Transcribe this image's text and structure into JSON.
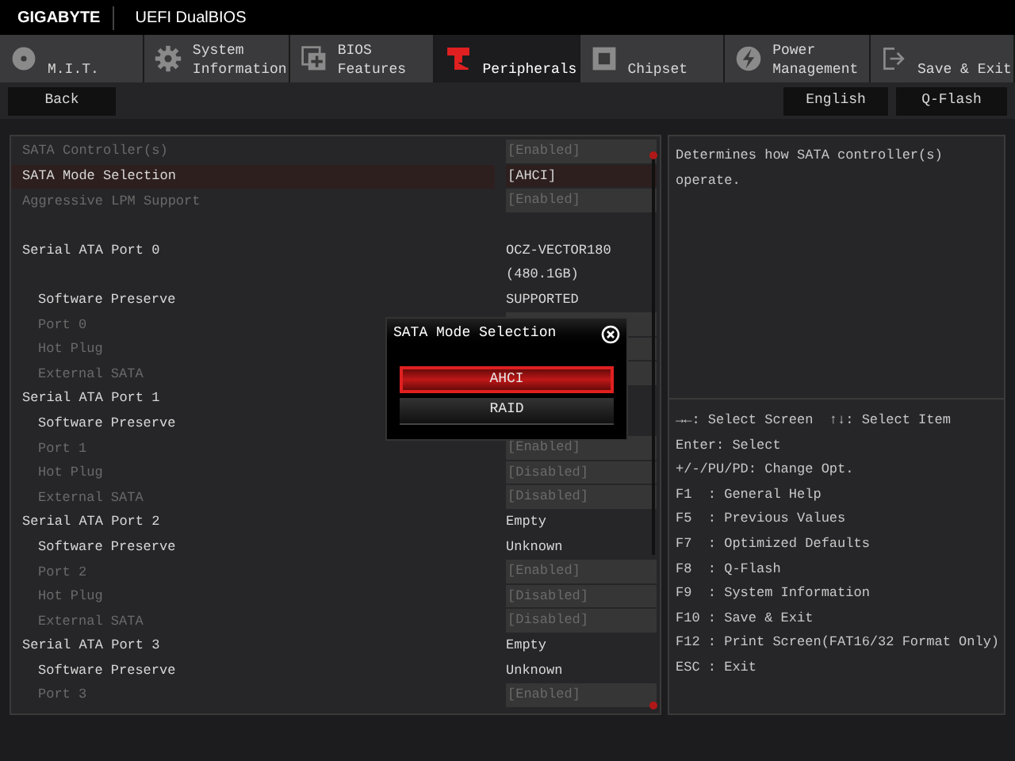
{
  "header": {
    "brand": "GIGABYTE",
    "title": "UEFI DualBIOS"
  },
  "tabs": [
    {
      "label": "M.I.T.",
      "selected": false
    },
    {
      "label": "System Information",
      "selected": false
    },
    {
      "label": "BIOS Features",
      "selected": false
    },
    {
      "label": "Peripherals",
      "selected": true
    },
    {
      "label": "Chipset",
      "selected": false
    },
    {
      "label": "Power Management",
      "selected": false
    },
    {
      "label": "Save & Exit",
      "selected": false
    }
  ],
  "toolbar": {
    "back": "Back",
    "language": "English",
    "qflash": "Q-Flash"
  },
  "settings": [
    {
      "items": [
        {
          "label": "SATA Controller(s)",
          "kind": "option",
          "value": "[Enabled]",
          "disabled": true,
          "selected": false
        },
        {
          "label": "SATA Mode Selection",
          "kind": "option",
          "value": "[AHCI]",
          "disabled": false,
          "selected": true
        },
        {
          "label": "Aggressive LPM Support",
          "kind": "option",
          "value": "[Enabled]",
          "disabled": true,
          "selected": false
        }
      ]
    },
    {
      "items": [
        {
          "label": "Serial ATA Port 0",
          "kind": "info",
          "value_lines": [
            "OCZ-VECTOR180",
            "(480.1GB)"
          ],
          "children": [
            {
              "label": "Software Preserve",
              "kind": "info",
              "value_lines": [
                "SUPPORTED"
              ]
            },
            {
              "label": "Port 0",
              "kind": "option",
              "disabled": true,
              "selected": false
            },
            {
              "label": "Hot Plug",
              "kind": "option",
              "disabled": true,
              "selected": false
            },
            {
              "label": "External SATA",
              "kind": "option",
              "disabled": true,
              "selected": false
            }
          ]
        },
        {
          "label": "Serial ATA Port 1",
          "kind": "info",
          "children": [
            {
              "label": "Software Preserve",
              "kind": "info"
            },
            {
              "label": "Port 1",
              "kind": "option",
              "value": "[Enabled]",
              "disabled": true,
              "selected": false
            },
            {
              "label": "Hot Plug",
              "kind": "option",
              "value": "[Disabled]",
              "disabled": true,
              "selected": false
            },
            {
              "label": "External SATA",
              "kind": "option",
              "value": "[Disabled]",
              "disabled": true,
              "selected": false
            }
          ]
        },
        {
          "label": "Serial ATA Port 2",
          "kind": "info",
          "value_lines": [
            "Empty"
          ],
          "children": [
            {
              "label": "Software Preserve",
              "kind": "info",
              "value_lines": [
                "Unknown"
              ]
            },
            {
              "label": "Port 2",
              "kind": "option",
              "value": "[Enabled]",
              "disabled": true,
              "selected": false
            },
            {
              "label": "Hot Plug",
              "kind": "option",
              "value": "[Disabled]",
              "disabled": true,
              "selected": false
            },
            {
              "label": "External SATA",
              "kind": "option",
              "value": "[Disabled]",
              "disabled": true,
              "selected": false
            }
          ]
        },
        {
          "label": "Serial ATA Port 3",
          "kind": "info",
          "value_lines": [
            "Empty"
          ],
          "children": [
            {
              "label": "Software Preserve",
              "kind": "info",
              "value_lines": [
                "Unknown"
              ]
            },
            {
              "label": "Port 3",
              "kind": "option",
              "value": "[Enabled]",
              "disabled": true,
              "selected": false
            }
          ]
        }
      ]
    }
  ],
  "popup": {
    "title": "SATA Mode Selection",
    "options": [
      {
        "label": "AHCI",
        "selected": true
      },
      {
        "label": "RAID",
        "selected": false
      }
    ]
  },
  "description": "Determines how SATA controller(s) operate.",
  "help": [
    "→←: Select Screen  ↑↓: Select Item",
    "Enter: Select",
    "+/-/PU/PD: Change Opt.",
    "F1  : General Help",
    "F5  : Previous Values",
    "F7  : Optimized Defaults",
    "F8  : Q-Flash",
    "F9  : System Information",
    "F10 : Save & Exit",
    "F12 : Print Screen(FAT16/32 Format Only)",
    "ESC : Exit"
  ]
}
